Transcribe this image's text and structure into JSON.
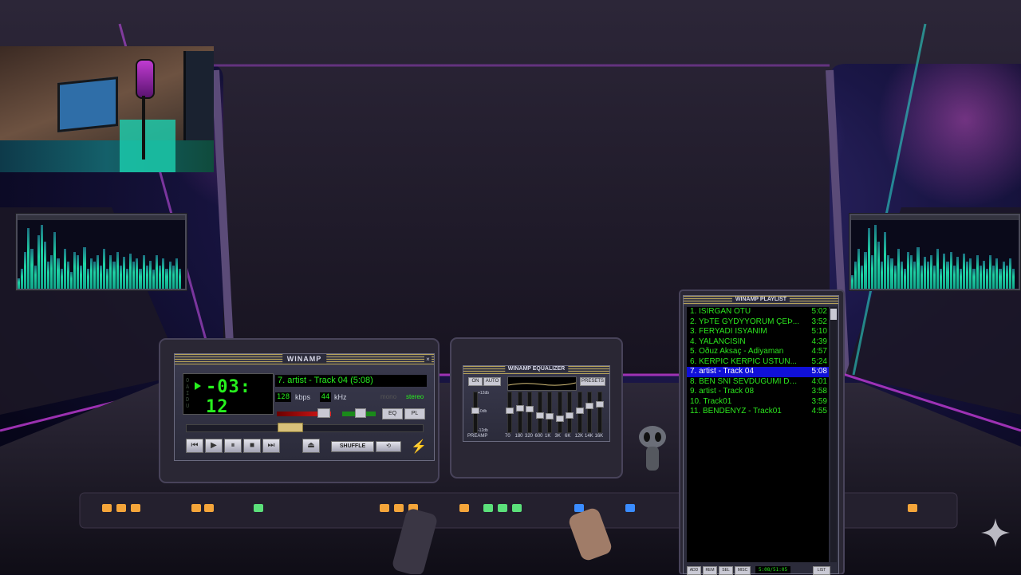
{
  "main_player": {
    "title": "WINAMP",
    "close_glyph": "×",
    "time": "-03: 12",
    "track_display": "7. artist - Track 04 (5:08)",
    "bitrate": "128",
    "bitrate_unit": "kbps",
    "samplerate": "44",
    "samplerate_unit": "kHz",
    "mono_label": "mono",
    "stereo_label": "stereo",
    "eq_toggle": "EQ",
    "pl_toggle": "PL",
    "shuffle_label": "SHUFFLE",
    "buttons": {
      "prev": "⏮",
      "play": "▶",
      "pause": "⏸",
      "stop": "■",
      "next": "⏭",
      "eject": "⏏"
    },
    "volume_fraction": 0.86,
    "seek_fraction": 0.39
  },
  "equalizer": {
    "title": "WINAMP EQUALIZER",
    "on_label": "ON",
    "auto_label": "AUTO",
    "presets_label": "PRESETS",
    "preamp_label": "PREAMP",
    "db_top": "+12db",
    "db_mid": "+0db",
    "db_bottom": "-12db",
    "bands": [
      "70",
      "180",
      "320",
      "600",
      "1K",
      "3K",
      "6K",
      "12K",
      "14K",
      "16K"
    ],
    "preamp_level": 0.55,
    "band_levels": [
      0.55,
      0.62,
      0.58,
      0.42,
      0.38,
      0.32,
      0.4,
      0.55,
      0.68,
      0.72
    ]
  },
  "playlist": {
    "title": "WINAMP PLAYLIST",
    "items": [
      {
        "name": "1. ISIRGAN OTU",
        "duration": "5:02"
      },
      {
        "name": "2. YÞTE GYDÝYORUM ÇEÞ...",
        "duration": "3:52"
      },
      {
        "name": "3. FERYADI ISYANIM",
        "duration": "5:10"
      },
      {
        "name": "4. YALANCISIN",
        "duration": "4:39"
      },
      {
        "name": "5. Oðuz Aksaç - Adiyaman",
        "duration": "4:57"
      },
      {
        "name": "6. KERPIC KERPIC USTUN...",
        "duration": "5:24"
      },
      {
        "name": "7. artist - Track 04",
        "duration": "5:08",
        "selected": true
      },
      {
        "name": "8. BEN SNI SEVDUGUMI DU...",
        "duration": "4:01"
      },
      {
        "name": "9. artist - Track 08",
        "duration": "3:58"
      },
      {
        "name": "10. Track01",
        "duration": "3:59"
      },
      {
        "name": "11. BENDENYZ - Track01",
        "duration": "4:55"
      }
    ],
    "footer_buttons": [
      "ADD",
      "REM",
      "SEL",
      "MISC"
    ],
    "footer_time": "5:08/51:05",
    "list_button": "LIST"
  },
  "visualizer_left": {
    "levels": [
      0.15,
      0.3,
      0.55,
      0.9,
      0.6,
      0.35,
      0.8,
      0.95,
      0.7,
      0.4,
      0.5,
      0.85,
      0.45,
      0.3,
      0.6,
      0.4,
      0.25,
      0.55,
      0.5,
      0.35,
      0.62,
      0.3,
      0.45,
      0.4,
      0.5,
      0.35,
      0.6,
      0.3,
      0.5,
      0.4,
      0.55,
      0.35,
      0.48,
      0.3,
      0.52,
      0.4,
      0.45,
      0.3,
      0.5,
      0.35,
      0.42,
      0.28,
      0.5,
      0.35,
      0.45,
      0.3,
      0.4,
      0.35,
      0.45,
      0.3
    ]
  },
  "visualizer_right": {
    "levels": [
      0.2,
      0.4,
      0.6,
      0.35,
      0.55,
      0.9,
      0.5,
      0.95,
      0.7,
      0.4,
      0.85,
      0.5,
      0.45,
      0.35,
      0.6,
      0.4,
      0.3,
      0.55,
      0.5,
      0.4,
      0.62,
      0.35,
      0.48,
      0.4,
      0.5,
      0.35,
      0.6,
      0.3,
      0.52,
      0.4,
      0.55,
      0.35,
      0.48,
      0.3,
      0.52,
      0.4,
      0.45,
      0.3,
      0.5,
      0.35,
      0.42,
      0.3,
      0.5,
      0.35,
      0.45,
      0.3,
      0.4,
      0.35,
      0.45,
      0.3
    ]
  },
  "colors": {
    "lcd_green": "#27f01e",
    "playlist_text": "#2ce71e",
    "playlist_selected_bg": "#1010d8",
    "viz_bar": "#1fd3a5",
    "cockpit_frame": "#2a2336",
    "neon_magenta": "#c13bd6"
  },
  "webcam": {
    "label": "webcam overlay"
  },
  "background": {
    "panel_buttons_amber": 10,
    "panel_buttons_green": 4,
    "panel_buttons_blue": 2
  }
}
